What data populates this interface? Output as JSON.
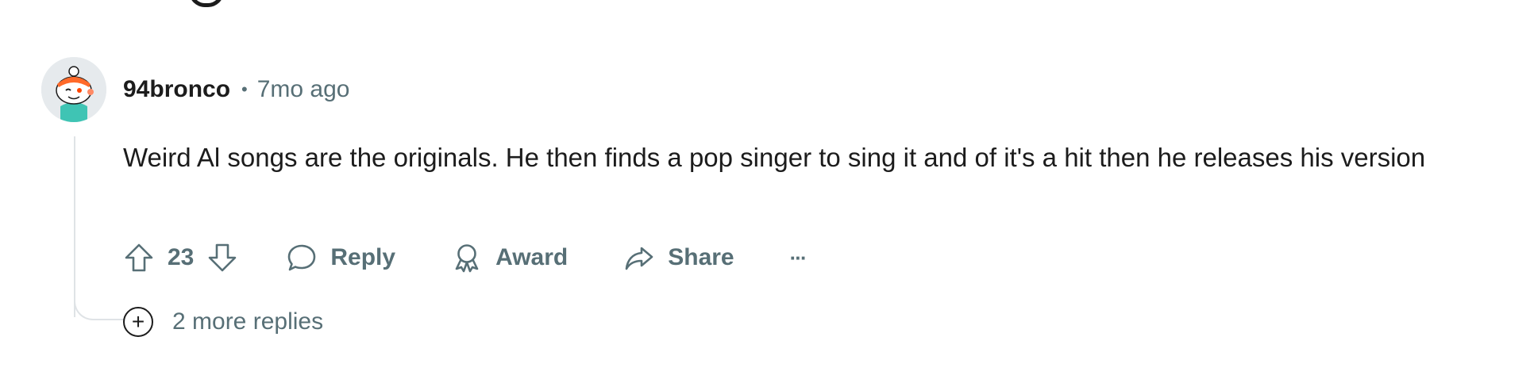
{
  "comment": {
    "username": "94bronco",
    "separator": "•",
    "timestamp": "7mo ago",
    "body": "Weird Al songs are the originals. He then finds a pop singer to sing it and of it's a hit then he releases his version",
    "score": "23"
  },
  "actions": {
    "reply_label": "Reply",
    "award_label": "Award",
    "share_label": "Share",
    "more_label": "···"
  },
  "replies": {
    "expand_icon": "+",
    "more_label": "2 more replies"
  },
  "icons": {
    "upvote": "upvote-arrow-icon",
    "downvote": "downvote-arrow-icon",
    "reply": "speech-bubble-icon",
    "award": "award-ribbon-icon",
    "share": "share-arrow-icon",
    "expand": "plus-circle-icon"
  },
  "colors": {
    "text_primary": "#1c1c1c",
    "text_secondary": "#576f76",
    "thread_line": "#dfe3e6"
  }
}
